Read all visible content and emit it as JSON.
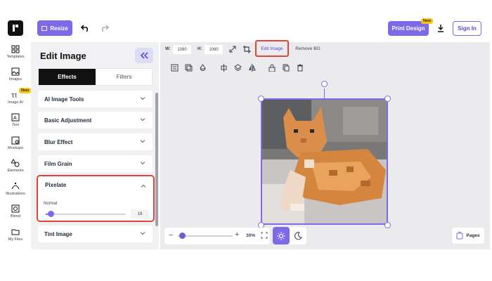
{
  "header": {
    "resize_label": "Resize",
    "print_label": "Print Design",
    "print_badge": "New",
    "signin_label": "Sign In"
  },
  "rail": {
    "items": [
      {
        "label": "Templates",
        "icon": "templates-icon"
      },
      {
        "label": "Images",
        "icon": "images-icon"
      },
      {
        "label": "Image AI",
        "icon": "text-ai-icon"
      },
      {
        "label": "Text",
        "icon": "text-icon"
      },
      {
        "label": "Mockups",
        "icon": "mockups-icon"
      },
      {
        "label": "Elements",
        "icon": "elements-icon"
      },
      {
        "label": "Illustrations",
        "icon": "illustrations-icon"
      },
      {
        "label": "Blend",
        "icon": "blend-icon"
      },
      {
        "label": "My Files",
        "icon": "folder-icon"
      }
    ],
    "image_ai_badge": "New"
  },
  "panel": {
    "title": "Edit Image",
    "tabs": [
      "Effects",
      "Filters"
    ],
    "accordions": [
      "AI Image Tools",
      "Basic Adjustment",
      "Blur Effect",
      "Film Grain"
    ],
    "pixelate": {
      "title": "Pixelate",
      "mode": "Normal",
      "value": "18",
      "slider_fraction": 0.05
    },
    "tint_label": "Tint Image"
  },
  "toolbar": {
    "w_label": "W:",
    "w_value": "1080",
    "h_label": "H:",
    "h_value": "1080",
    "edit_image_label": "Edit Image",
    "remove_bg_label": "Remove BG"
  },
  "canvas": {
    "zoom_value": "30%",
    "pages_label": "Pages"
  },
  "colors": {
    "accent": "#7c6ae6",
    "highlight": "#e0453a",
    "badge": "#f5c518"
  }
}
